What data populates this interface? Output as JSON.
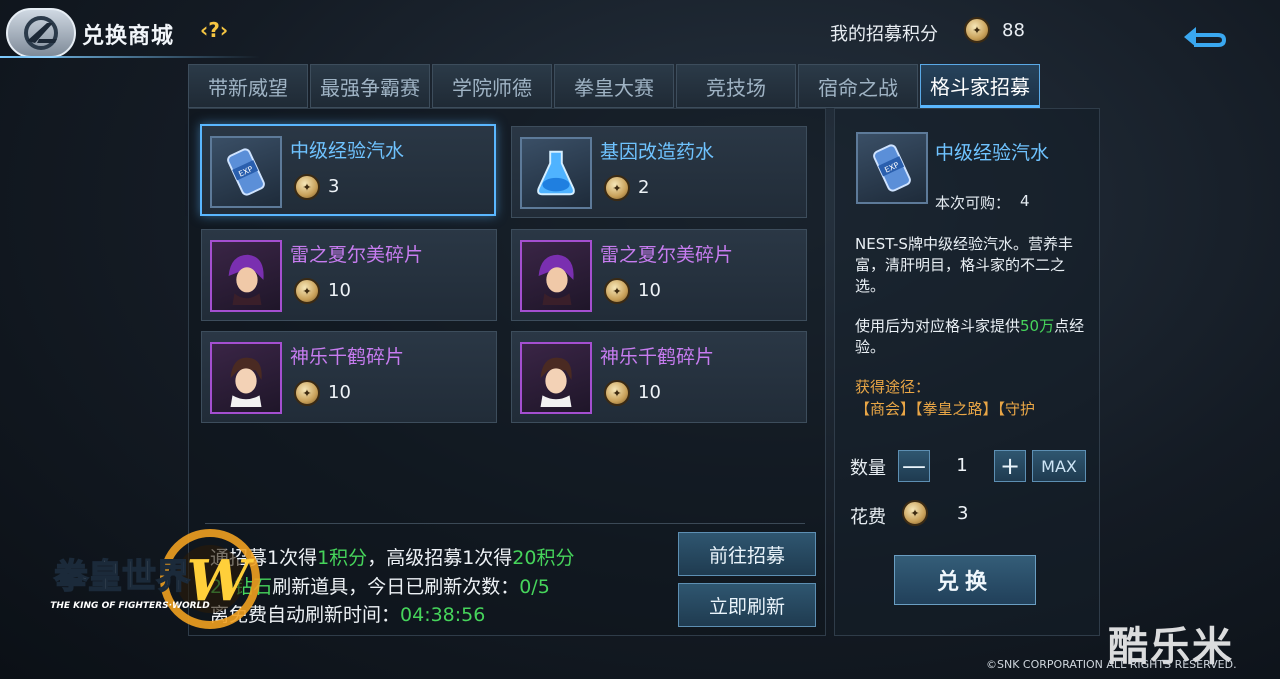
{
  "header": {
    "title": "兑换商城",
    "help_label": "?",
    "points_label": "我的招募积分",
    "points_value": "88"
  },
  "tabs": [
    {
      "label": "带新威望"
    },
    {
      "label": "最强争霸赛"
    },
    {
      "label": "学院师德"
    },
    {
      "label": "拳皇大赛"
    },
    {
      "label": "竞技场"
    },
    {
      "label": "宿命之战"
    },
    {
      "label": "格斗家招募",
      "active": true
    }
  ],
  "items": [
    {
      "name": "中级经验汽水",
      "price": "3",
      "rarity": "blue",
      "icon": "exp-soda-icon",
      "selected": true
    },
    {
      "name": "基因改造药水",
      "price": "2",
      "rarity": "blue",
      "icon": "potion-flask-icon"
    },
    {
      "name": "雷之夏尔美碎片",
      "price": "10",
      "rarity": "purple",
      "icon": "shermie-portrait-icon"
    },
    {
      "name": "雷之夏尔美碎片",
      "price": "10",
      "rarity": "purple",
      "icon": "shermie-portrait-icon"
    },
    {
      "name": "神乐千鹤碎片",
      "price": "10",
      "rarity": "purple",
      "icon": "chizuru-portrait-icon"
    },
    {
      "name": "神乐千鹤碎片",
      "price": "10",
      "rarity": "purple",
      "icon": "chizuru-portrait-icon"
    }
  ],
  "info": {
    "line1_a": "通招募1次得",
    "line1_b": "1积分",
    "line1_c": "，高级招募1次得",
    "line1_d": "20积分",
    "line2_a": "20钻石",
    "line2_b": "刷新道具，今日已刷新次数：",
    "line2_c": "0/5",
    "line3_a": "离免费自动刷新时间：",
    "line3_b": "04:38:56",
    "goto_recruit": "前往招募",
    "refresh_now": "立即刷新"
  },
  "detail": {
    "name": "中级经验汽水",
    "limit_label": "本次可购：",
    "limit_value": "4",
    "desc1": "NEST-S牌中级经验汽水。营养丰富，清肝明目，格斗家的不二之选。",
    "desc2_a": "使用后为对应格斗家提供",
    "desc2_b": "50万",
    "desc2_c": "点经验。",
    "source_label": "获得途径：",
    "source": "【商会】【拳皇之路】【守护",
    "qty_label": "数量",
    "qty_minus": "—",
    "qty_value": "1",
    "qty_plus": "+",
    "qty_max": "MAX",
    "cost_label": "花费",
    "cost_value": "3",
    "exchange_label": "兑换"
  },
  "branding": {
    "game_logo_title": "拳皇世界",
    "game_logo_subtitle": "THE KING OF FIGHTERS·WORLD",
    "watermark": "酷乐米",
    "copyright": "©SNK CORPORATION ALL RIGHTS RESERVED."
  },
  "colors": {
    "accent_blue": "#5ab7ff",
    "blue_item": "#6fc3ff",
    "purple_item": "#c77cf0",
    "green_highlight": "#46d45b",
    "orange_source": "#e9a646"
  }
}
